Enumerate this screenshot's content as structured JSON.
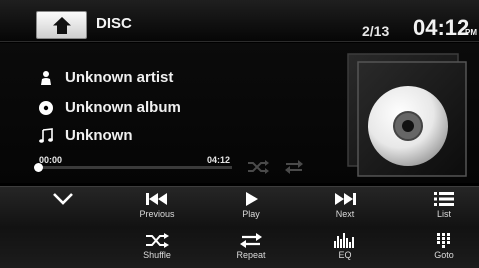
{
  "header": {
    "source": "DISC",
    "track_counter": "2/13",
    "time": "04:12",
    "ampm": "PM"
  },
  "track": {
    "artist": "Unknown artist",
    "album": "Unknown album",
    "title": "Unknown"
  },
  "progress": {
    "elapsed": "00:00",
    "total": "04:12",
    "fraction": 0.0
  },
  "controls": {
    "row1": [
      {
        "id": "collapse",
        "label": "",
        "icon": "chevron-down-icon"
      },
      {
        "id": "previous",
        "label": "Previous",
        "icon": "previous-icon"
      },
      {
        "id": "play",
        "label": "Play",
        "icon": "play-icon"
      },
      {
        "id": "next",
        "label": "Next",
        "icon": "next-icon"
      },
      {
        "id": "list",
        "label": "List",
        "icon": "list-icon"
      }
    ],
    "row2": [
      {
        "id": "shuffle",
        "label": "Shuffle",
        "icon": "shuffle-icon"
      },
      {
        "id": "repeat",
        "label": "Repeat",
        "icon": "repeat-icon"
      },
      {
        "id": "eq",
        "label": "EQ",
        "icon": "equalizer-icon"
      },
      {
        "id": "goto",
        "label": "Goto",
        "icon": "keypad-icon"
      }
    ]
  },
  "colors": {
    "background": "#000000",
    "text": "#ffffff",
    "home_button": "#e8e8e8"
  }
}
